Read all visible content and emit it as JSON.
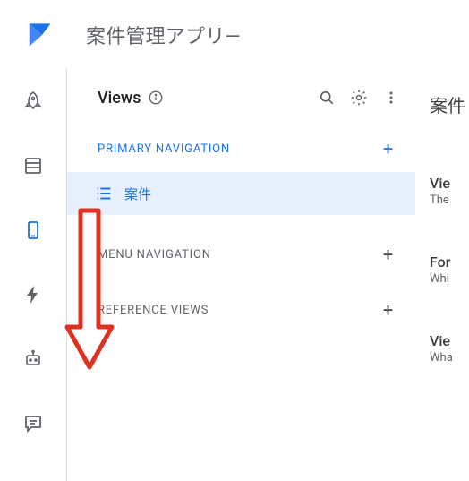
{
  "header": {
    "app_title": "案件管理アプリ―"
  },
  "views": {
    "title": "Views",
    "sections": {
      "primary": {
        "label": "PRIMARY NAVIGATION"
      },
      "menu": {
        "label": "MENU NAVIGATION"
      },
      "reference": {
        "label": "REFERENCE VIEWS"
      }
    },
    "items": {
      "anken": {
        "label": "案件"
      }
    }
  },
  "right": {
    "heading": "案件",
    "view_name": {
      "h": "Vie",
      "s": "The"
    },
    "for_table": {
      "h": "For",
      "s": "Whi"
    },
    "view_type": {
      "h": "Vie",
      "s": "Wha"
    }
  },
  "icons": {
    "logo": "appsheet-logo",
    "rocket": "rocket-icon",
    "list": "list-icon",
    "device": "device-icon",
    "bolt": "bolt-icon",
    "robot": "robot-icon",
    "chat": "chat-icon",
    "info": "info-icon",
    "search": "search-icon",
    "gear": "gear-icon",
    "more": "more-icon",
    "listview": "list-view-icon",
    "plus": "plus-icon"
  }
}
